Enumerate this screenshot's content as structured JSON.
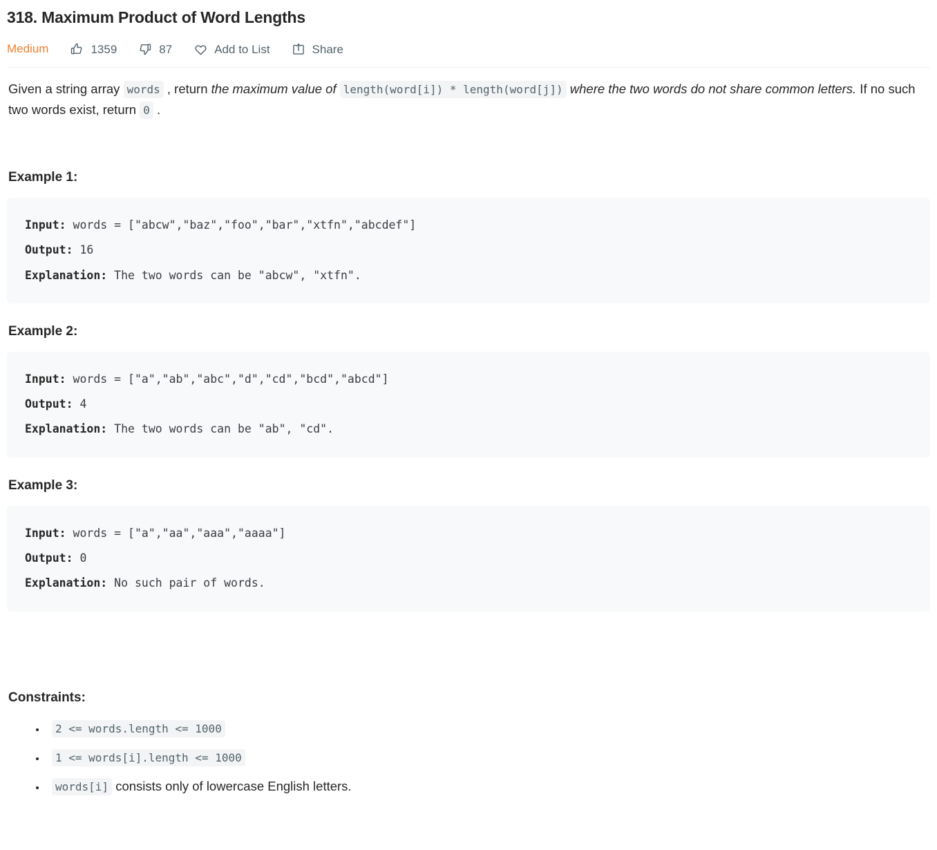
{
  "problem": {
    "title": "318. Maximum Product of Word Lengths",
    "difficulty": "Medium",
    "actions": {
      "likes": "1359",
      "dislikes": "87",
      "add_to_list": "Add to List",
      "share": "Share"
    },
    "icons": {
      "like": "thumbs-up-icon",
      "dislike": "thumbs-down-icon",
      "add_to_list": "heart-icon",
      "share": "share-box-icon"
    },
    "colors": {
      "difficulty_medium": "#ef7f2e",
      "text_primary": "#262626",
      "text_muted": "#52636b",
      "code_block_bg": "#f7f9fa",
      "inline_code_bg": "#f2f4f5",
      "divider": "#eceff1"
    },
    "description": {
      "part1": "Given a string array ",
      "code1": "words",
      "part2": " , return ",
      "em1": "the maximum value of ",
      "code2": "length(word[i]) * length(word[j])",
      "em2": " where the two words do not share common letters.",
      "part3": " If no such two words exist, return ",
      "code3": "0",
      "part4": " ."
    },
    "examples": [
      {
        "heading": "Example 1:",
        "input_label": "Input:",
        "input_value": " words = [\"abcw\",\"baz\",\"foo\",\"bar\",\"xtfn\",\"abcdef\"]",
        "output_label": "Output:",
        "output_value": " 16",
        "explanation_label": "Explanation:",
        "explanation_value": " The two words can be \"abcw\", \"xtfn\"."
      },
      {
        "heading": "Example 2:",
        "input_label": "Input:",
        "input_value": " words = [\"a\",\"ab\",\"abc\",\"d\",\"cd\",\"bcd\",\"abcd\"]",
        "output_label": "Output:",
        "output_value": " 4",
        "explanation_label": "Explanation:",
        "explanation_value": " The two words can be \"ab\", \"cd\"."
      },
      {
        "heading": "Example 3:",
        "input_label": "Input:",
        "input_value": " words = [\"a\",\"aa\",\"aaa\",\"aaaa\"]",
        "output_label": "Output:",
        "output_value": " 0",
        "explanation_label": "Explanation:",
        "explanation_value": " No such pair of words."
      }
    ],
    "constraints": {
      "heading": "Constraints:",
      "items": [
        {
          "code": "2 <= words.length <= 1000",
          "text": ""
        },
        {
          "code": "1 <= words[i].length <= 1000",
          "text": ""
        },
        {
          "code": "words[i]",
          "text": " consists only of lowercase English letters."
        }
      ]
    }
  }
}
